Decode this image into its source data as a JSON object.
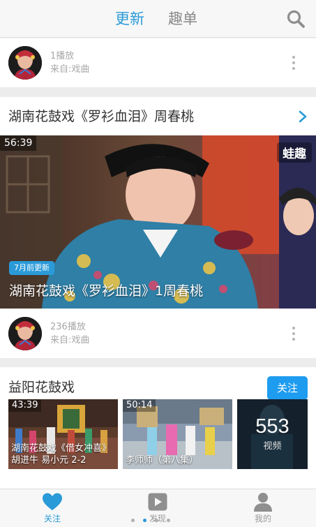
{
  "header": {
    "tabs": [
      {
        "label": "更新",
        "active": true
      },
      {
        "label": "趣单",
        "active": false
      }
    ],
    "search_icon": "search-icon"
  },
  "feed": [
    {
      "channel_stats": {
        "plays": "1播放",
        "source": "来自:戏曲"
      }
    },
    {
      "title": "湖南花鼓戏《罗衫血泪》周春桃",
      "video": {
        "duration": "56:39",
        "watermark": "蛙趣",
        "updated_badge": "7月前更新",
        "title": "湖南花鼓戏《罗衫血泪》1周春桃"
      },
      "channel_stats": {
        "plays": "236播放",
        "source": "来自:戏曲"
      }
    }
  ],
  "playlist": {
    "title": "益阳花鼓戏",
    "follow_label": "关注",
    "items": [
      {
        "duration": "43:39",
        "title": "湖南花鼓戏《借女冲喜》胡进牛 易小元 2-2"
      },
      {
        "duration": "50:14",
        "title": "李师师（第八集）"
      }
    ],
    "count": {
      "value": "553",
      "label": "视频"
    }
  },
  "bottom_nav": {
    "items": [
      {
        "label": "关注",
        "icon": "heart-icon",
        "active": true
      },
      {
        "label": "发现",
        "icon": "play-icon",
        "active": false
      },
      {
        "label": "我的",
        "icon": "user-icon",
        "active": false
      }
    ],
    "page_dots": 4
  },
  "colors": {
    "accent": "#2a9ad8",
    "follow_button": "#1e9cf0"
  }
}
